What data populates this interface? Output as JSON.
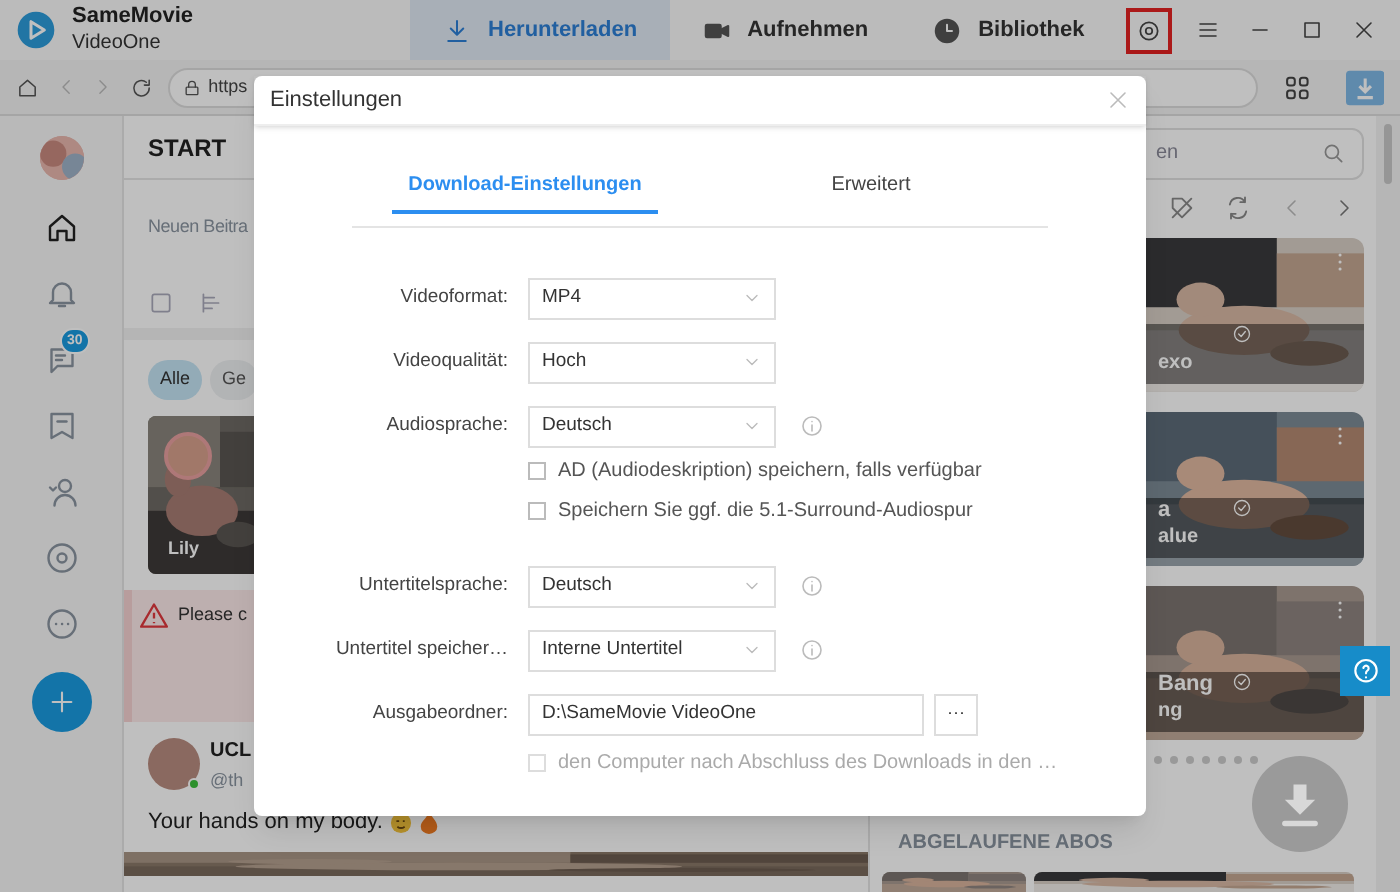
{
  "app": {
    "name": "SameMovie",
    "subtitle": "VideoOne"
  },
  "nav_tabs": [
    {
      "label": "Herunterladen",
      "selected": true,
      "kind": "download"
    },
    {
      "label": "Aufnehmen",
      "selected": false,
      "kind": "record"
    },
    {
      "label": "Bibliothek",
      "selected": false,
      "kind": "library"
    }
  ],
  "settings_button": {
    "highlighted": true
  },
  "browser": {
    "url": "https"
  },
  "site": {
    "header": "START",
    "composer_placeholder": "Neuen Beitra",
    "messages_badge": "30",
    "filters": [
      {
        "label": "Alle",
        "selected": true
      },
      {
        "label": "Ge",
        "selected": false
      }
    ],
    "story": {
      "name": "Lily"
    },
    "warning": "Please c",
    "post": {
      "author": "UCL",
      "handle": "@th",
      "text": "Your hands on my body."
    },
    "search_placeholder": "en",
    "cards": [
      {
        "sub": "exo"
      },
      {
        "name": "a",
        "sub": "alue"
      },
      {
        "name": "Bang",
        "sub": "ng"
      }
    ],
    "section_title": "ABGELAUFENE ABOS"
  },
  "dialog": {
    "title": "Einstellungen",
    "tabs": [
      {
        "label": "Download-Einstellungen",
        "selected": true
      },
      {
        "label": "Erweitert",
        "selected": false
      }
    ],
    "rows": [
      {
        "kind": "select",
        "label": "Videoformat:",
        "value": "MP4",
        "info": false
      },
      {
        "kind": "select",
        "label": "Videoqualität:",
        "value": "Hoch",
        "info": false
      },
      {
        "kind": "select",
        "label": "Audiosprache:",
        "value": "Deutsch",
        "info": true
      },
      {
        "kind": "checkbox",
        "label": "AD (Audiodeskription) speichern, falls verfügbar",
        "checked": false
      },
      {
        "kind": "checkbox",
        "label": "Speichern Sie ggf. die 5.1-Surround-Audiospur",
        "checked": false
      },
      {
        "kind": "select",
        "label": "Untertitelsprache:",
        "value": "Deutsch",
        "info": true
      },
      {
        "kind": "select",
        "label": "Untertitel speicher…",
        "value": "Interne Untertitel",
        "info": true
      },
      {
        "kind": "folder",
        "label": "Ausgabeordner:",
        "value": "D:\\SameMovie VideoOne",
        "button": "···"
      },
      {
        "kind": "checkbox",
        "label": "den Computer nach Abschluss des Downloads in den …",
        "checked": false,
        "disabled": true
      }
    ]
  }
}
